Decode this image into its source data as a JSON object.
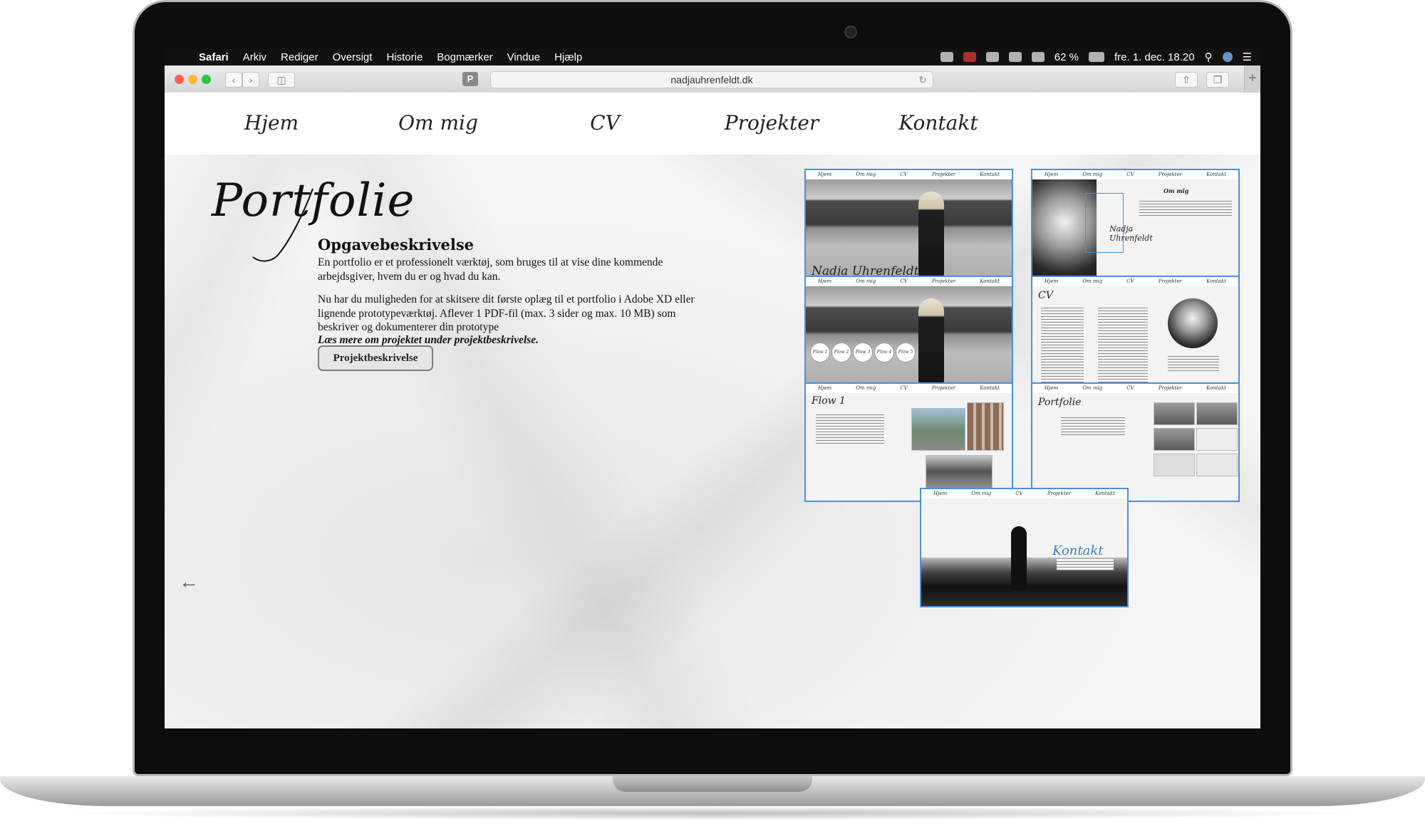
{
  "menubar": {
    "apple": "",
    "app": "Safari",
    "items": [
      "Arkiv",
      "Rediger",
      "Oversigt",
      "Historie",
      "Bogmærker",
      "Vindue",
      "Hjælp"
    ],
    "battery": "62 %",
    "clock": "fre. 1. dec. 18.20"
  },
  "browser": {
    "url": "nadjauhrenfeldt.dk",
    "pinned_tab_letter": "P",
    "back_glyph": "‹",
    "forward_glyph": "›",
    "reload_glyph": "↻",
    "newtab_glyph": "+"
  },
  "site_nav": {
    "items": [
      "Hjem",
      "Om mig",
      "CV",
      "Projekter",
      "Kontakt"
    ]
  },
  "main": {
    "title": "Portfolie",
    "heading": "Opgavebeskrivelse",
    "paragraph1": "En portfolio er et professionelt værktøj, som bruges til at vise dine kommende arbejdsgiver, hvem du er og hvad du kan.",
    "paragraph2": "Nu har du muligheden for at skitsere dit første oplæg til et portfolio i Adobe XD eller lignende prototypeværktøj. Aflever 1 PDF-fil (max. 3 sider og max. 10 MB) som beskriver og dokumenterer din prototype",
    "paragraph3": "Læs mere om projektet under projektbeskrivelse.",
    "button": "Projektbeskrivelse",
    "back_arrow": "←"
  },
  "thumbnails": {
    "nav": [
      "Hjem",
      "Om mig",
      "CV",
      "Projekter",
      "Kontakt"
    ],
    "hjem_signature": "Nadja Uhrenfeldt",
    "ommig_title": "Om mig",
    "ommig_name": "Nadja Uhrenfeldt",
    "flow_labels": [
      "Flow 1",
      "Flow 2",
      "Flow 3",
      "Flow 4",
      "Flow 5"
    ],
    "cv_title": "CV",
    "flow1_title": "Flow 1",
    "portfolie_title": "Portfolie",
    "kontakt_title": "Kontakt"
  },
  "colors": {
    "accent": "#4a90d9",
    "menubar": "#111111"
  }
}
